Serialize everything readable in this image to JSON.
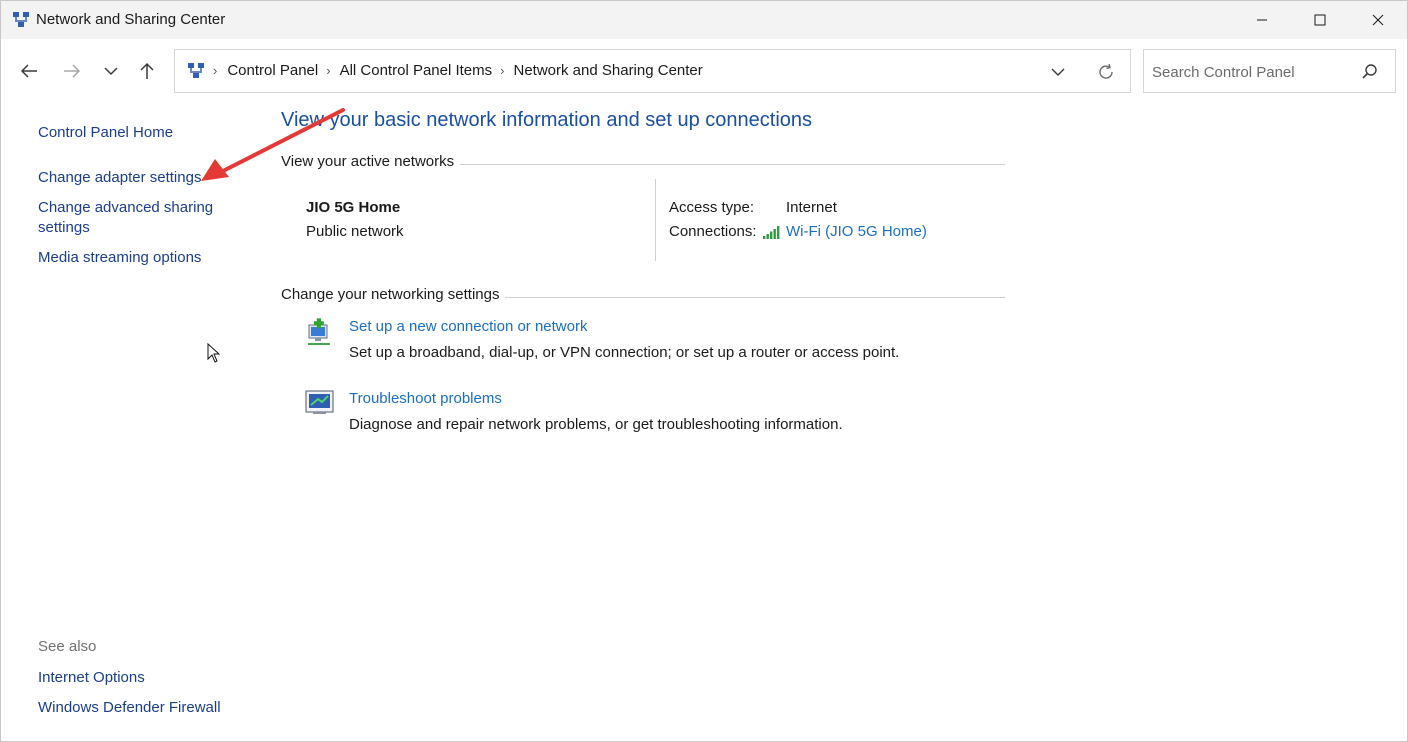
{
  "window": {
    "title": "Network and Sharing Center",
    "minimize_label": "Minimize",
    "maximize_label": "Maximize",
    "close_label": "Close"
  },
  "address": {
    "breadcrumbs": [
      "Control Panel",
      "All Control Panel Items",
      "Network and Sharing Center"
    ],
    "search_placeholder": "Search Control Panel"
  },
  "sidebar": {
    "links": [
      "Control Panel Home",
      "Change adapter settings",
      "Change advanced sharing settings",
      "Media streaming options"
    ],
    "see_also_heading": "See also",
    "see_also_links": [
      "Internet Options",
      "Windows Defender Firewall"
    ]
  },
  "main": {
    "title": "View your basic network information and set up connections",
    "active_networks_heading": "View your active networks",
    "network": {
      "name": "JIO 5G Home",
      "category": "Public network",
      "access_type_label": "Access type:",
      "access_type_value": "Internet",
      "connections_label": "Connections:",
      "connections_value": "Wi-Fi (JIO 5G Home)"
    },
    "settings_heading": "Change your networking settings",
    "tasks": [
      {
        "link": "Set up a new connection or network",
        "description": "Set up a broadband, dial-up, or VPN connection; or set up a router or access point.",
        "icon": "new-connection-icon"
      },
      {
        "link": "Troubleshoot problems",
        "description": "Diagnose and repair network problems, or get troubleshooting information.",
        "icon": "troubleshoot-icon"
      }
    ]
  },
  "colors": {
    "link": "#1a6fc0",
    "title": "#1a4fa0",
    "annotation_arrow": "#e53935"
  }
}
